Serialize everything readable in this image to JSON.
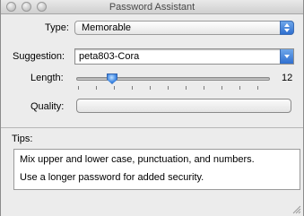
{
  "window": {
    "title": "Password Assistant"
  },
  "form": {
    "type_label": "Type:",
    "type_value": "Memorable",
    "suggestion_label": "Suggestion:",
    "suggestion_value": "peta803-Cora",
    "length_label": "Length:",
    "length_value": "12",
    "quality_label": "Quality:",
    "quality_level": 0
  },
  "tips": {
    "label": "Tips:",
    "lines": [
      "Mix upper and lower case, punctuation, and numbers.",
      "Use a longer password for added security."
    ]
  }
}
